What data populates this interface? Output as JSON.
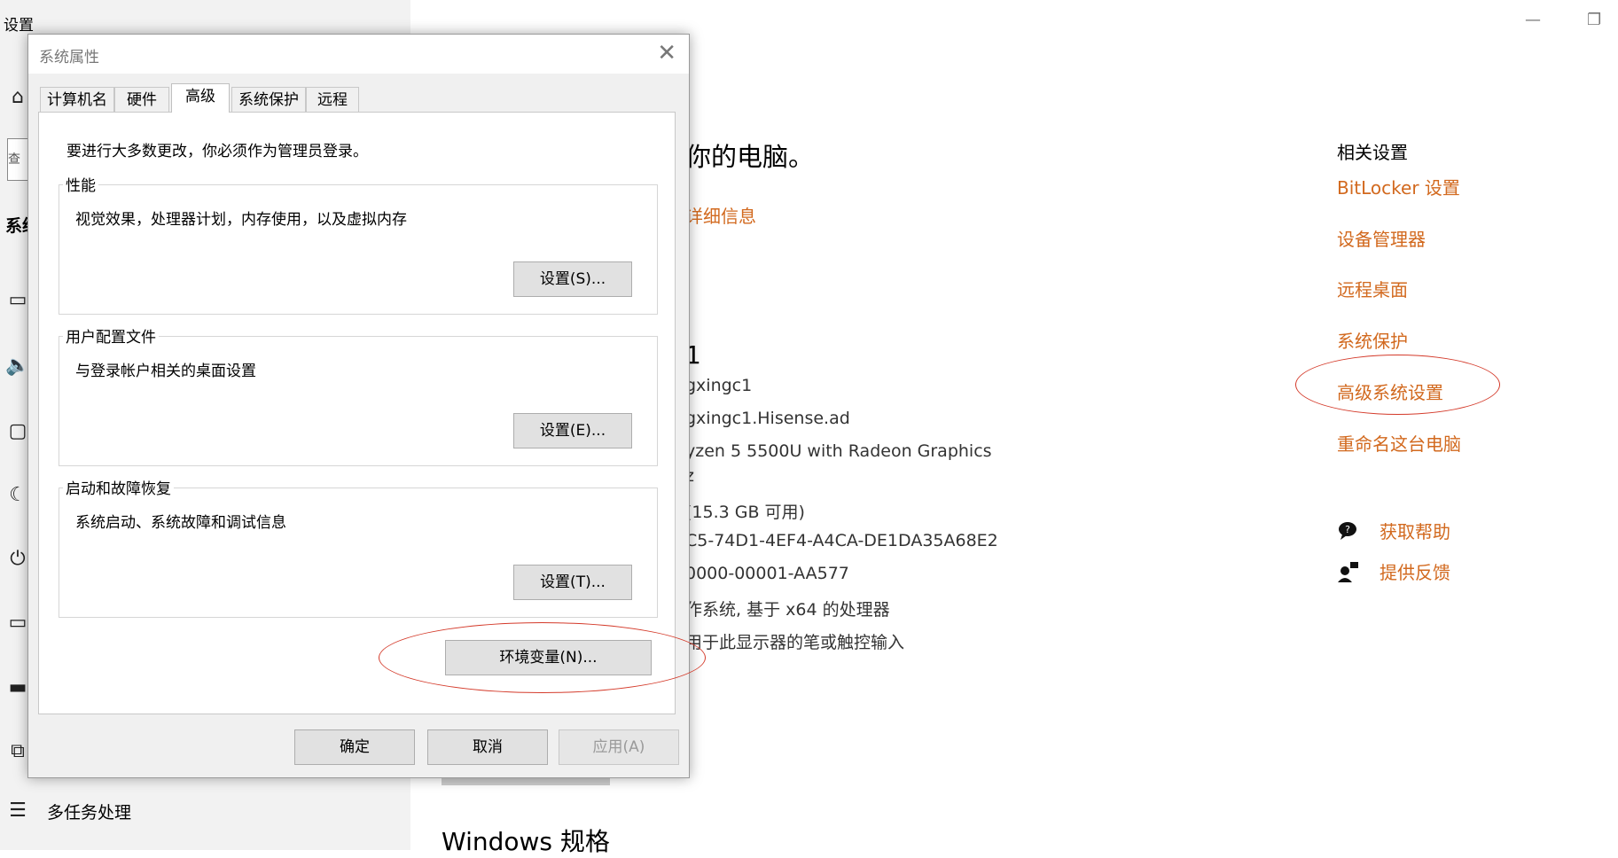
{
  "settings_app": {
    "title": "设置",
    "search_stub": "查",
    "system_stub": "系统",
    "multitask_label": "多任务处理",
    "nav_icons": [
      "home-icon",
      "display-icon",
      "sound-icon",
      "notifications-icon",
      "focus-assist-icon",
      "power-icon",
      "battery-icon",
      "storage-icon",
      "tablet-icon",
      "multitasking-icon"
    ],
    "window_controls": {
      "minimize": "—",
      "maximize": "❐"
    },
    "main": {
      "heading_fragment": "你的电脑。",
      "details_link_fragment": "详细信息",
      "device_name_fragment": "1",
      "specs": [
        "gxingc1",
        "gxingc1.Hisense.ad",
        "yzen 5 5500U with Radeon Graphics",
        "z",
        "(15.3 GB 可用)",
        "C5-74D1-4EF4-A4CA-DE1DA35A68E2",
        "0000-00001-AA577",
        "作系统, 基于 x64 的处理器",
        "用于此显示器的笔或触控输入"
      ],
      "windows_spec_heading": "Windows 规格"
    },
    "related": {
      "title": "相关设置",
      "links": [
        "BitLocker 设置",
        "设备管理器",
        "远程桌面",
        "系统保护",
        "高级系统设置",
        "重命名这台电脑"
      ],
      "help": "获取帮助",
      "feedback": "提供反馈"
    },
    "accent_color": "#d2691e"
  },
  "dialog": {
    "title": "系统属性",
    "close_glyph": "✕",
    "tabs": [
      "计算机名",
      "硬件",
      "高级",
      "系统保护",
      "远程"
    ],
    "active_tab": "高级",
    "intro": "要进行大多数更改，你必须作为管理员登录。",
    "groups": [
      {
        "title": "性能",
        "desc": "视觉效果，处理器计划，内存使用，以及虚拟内存",
        "button": "设置(S)..."
      },
      {
        "title": "用户配置文件",
        "desc": "与登录帐户相关的桌面设置",
        "button": "设置(E)..."
      },
      {
        "title": "启动和故障恢复",
        "desc": "系统启动、系统故障和调试信息",
        "button": "设置(T)..."
      }
    ],
    "env_button": "环境变量(N)...",
    "footer": {
      "ok": "确定",
      "cancel": "取消",
      "apply": "应用(A)"
    }
  },
  "annotation_color": "#d43a2a"
}
